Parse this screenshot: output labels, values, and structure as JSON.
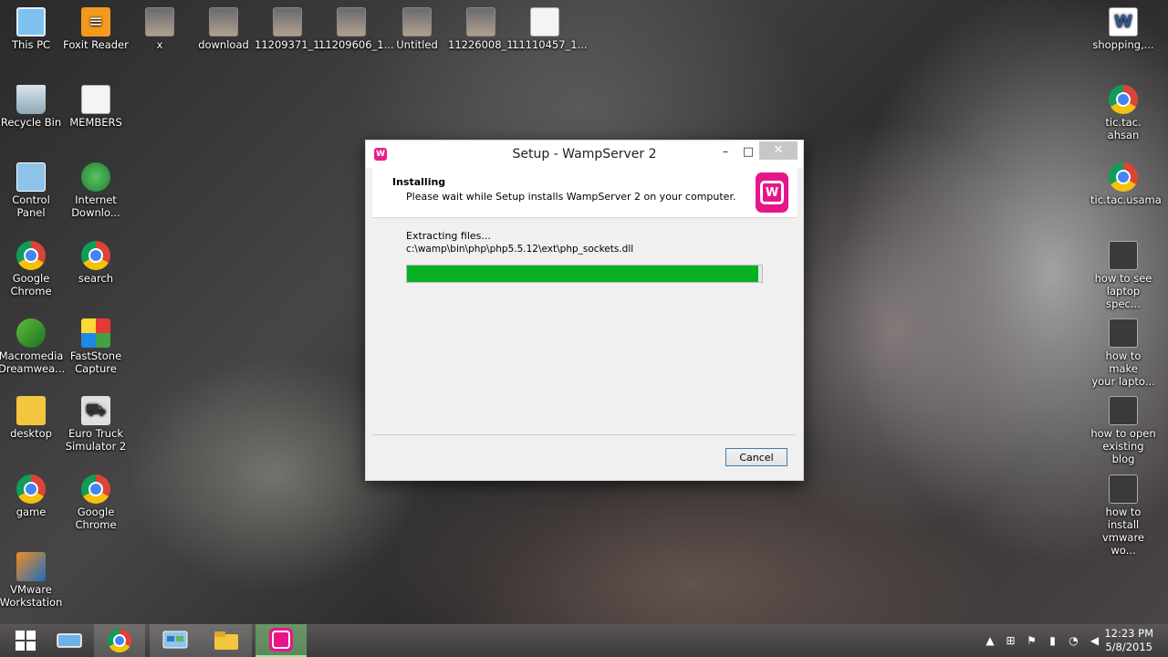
{
  "desktop": {
    "icons_left": [
      {
        "label": "This PC",
        "icon": "computer-icon"
      },
      {
        "label": "Foxit Reader",
        "icon": "pdf-reader-icon"
      },
      {
        "label": "x",
        "icon": "photo-icon"
      },
      {
        "label": "download",
        "icon": "photo-icon"
      },
      {
        "label": "11209371_1...",
        "icon": "photo-icon"
      },
      {
        "label": "11209606_1...",
        "icon": "photo-icon"
      },
      {
        "label": "Untitled",
        "icon": "photo-icon"
      },
      {
        "label": "11226008_1...",
        "icon": "photo-icon"
      },
      {
        "label": "11110457_1...",
        "icon": "document-icon"
      },
      {
        "label": "Recycle Bin",
        "icon": "recycle-bin-icon"
      },
      {
        "label": "MEMBERS",
        "icon": "document-icon"
      },
      {
        "label": "Control\nPanel",
        "icon": "control-panel-icon"
      },
      {
        "label": "Internet\nDownlo...",
        "icon": "globe-icon"
      },
      {
        "label": "Google\nChrome",
        "icon": "chrome-icon"
      },
      {
        "label": "search",
        "icon": "chrome-icon"
      },
      {
        "label": "Macromedia\nDreamwea...",
        "icon": "dreamweaver-icon"
      },
      {
        "label": "FastStone\nCapture",
        "icon": "capture-icon"
      },
      {
        "label": "desktop",
        "icon": "folder-icon"
      },
      {
        "label": "Euro Truck\nSimulator 2",
        "icon": "truck-icon"
      },
      {
        "label": "game",
        "icon": "chrome-icon"
      },
      {
        "label": "Google\nChrome",
        "icon": "chrome-icon"
      },
      {
        "label": "VMware\nWorkstation",
        "icon": "vmware-icon"
      }
    ],
    "icons_right": [
      {
        "label": "shopping,...",
        "icon": "word-document-icon"
      },
      {
        "label": "tic.tac. ahsan",
        "icon": "chrome-icon"
      },
      {
        "label": "tic.tac.usama",
        "icon": "chrome-icon"
      },
      {
        "label": "how to see\nlaptop spec...",
        "icon": "video-icon"
      },
      {
        "label": "how to make\nyour lapto...",
        "icon": "video-icon"
      },
      {
        "label": "how to open\nexisting blog",
        "icon": "video-icon"
      },
      {
        "label": "how to install\nvmware wo...",
        "icon": "video-icon"
      }
    ]
  },
  "dialog": {
    "title": "Setup - WampServer 2",
    "minimize": "–",
    "maximize": "□",
    "close": "✕",
    "app_icon_letter": "W",
    "header_title": "Installing",
    "header_subtitle": "Please wait while Setup installs WampServer 2 on your computer.",
    "status_text": "Extracting files...",
    "current_file": "c:\\wamp\\bin\\php\\php5.5.12\\ext\\php_sockets.dll",
    "progress_fraction": 0.99,
    "cancel_label": "Cancel",
    "logo_letter": "W"
  },
  "taskbar": {
    "items": [
      {
        "icon": "windows-start-icon"
      },
      {
        "icon": "network-share-icon"
      },
      {
        "icon": "chrome-icon"
      },
      {
        "icon": "control-panel-icon"
      },
      {
        "icon": "file-explorer-icon"
      },
      {
        "icon": "wampserver-icon"
      }
    ],
    "tray_icons": [
      "chevron-up-icon",
      "network-icon",
      "flag-icon",
      "battery-icon",
      "wifi-icon",
      "volume-icon"
    ],
    "time": "12:23 PM",
    "date": "5/8/2015"
  },
  "colors": {
    "progress_green": "#06b025",
    "wamp_pink": "#e8158a"
  }
}
